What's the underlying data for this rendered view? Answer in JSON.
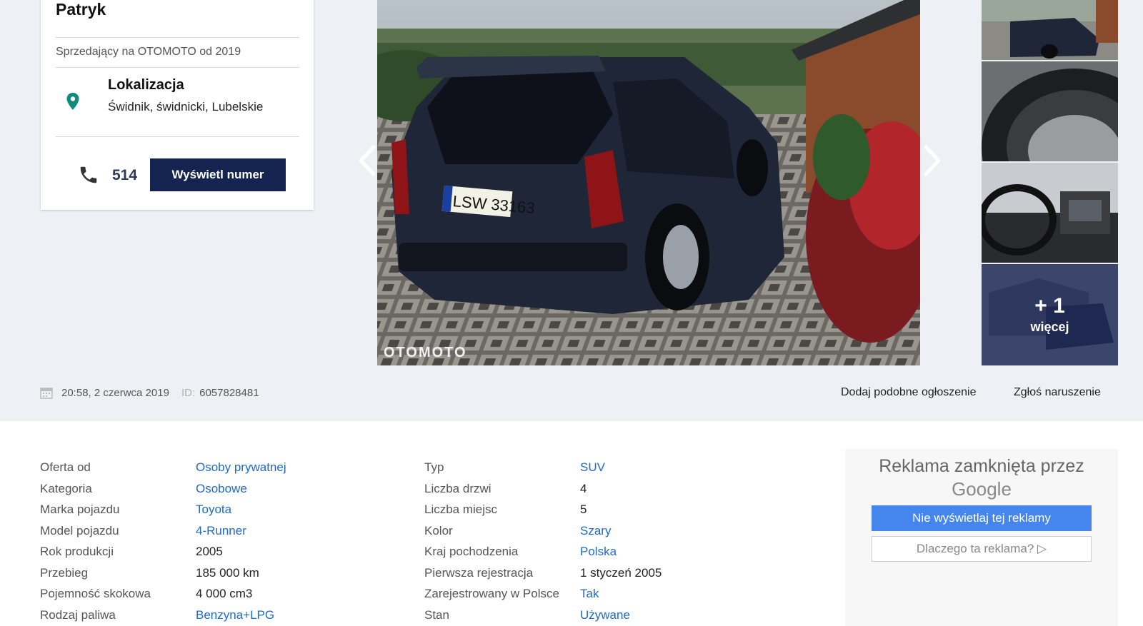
{
  "seller": {
    "name": "Patryk",
    "since": "Sprzedający na OTOMOTO od 2019",
    "location_label": "Lokalizacja",
    "location_value": "Świdnik, świdnicki, Lubelskie",
    "phone_prefix": "514",
    "show_number_label": "Wyświetl numer"
  },
  "gallery": {
    "watermark": "OTOMOTO",
    "plate": "LSW 33163",
    "more_count": "+ 1",
    "more_label": "więcej"
  },
  "meta": {
    "datetime": "20:58, 2 czerwca 2019",
    "id_label": "ID:",
    "id_value": "6057828481",
    "add_similar": "Dodaj podobne ogłoszenie",
    "report": "Zgłoś naruszenie"
  },
  "params_left": [
    {
      "label": "Oferta od",
      "value": "Osoby prywatnej",
      "link": true
    },
    {
      "label": "Kategoria",
      "value": "Osobowe",
      "link": true
    },
    {
      "label": "Marka pojazdu",
      "value": "Toyota",
      "link": true
    },
    {
      "label": "Model pojazdu",
      "value": "4-Runner",
      "link": true
    },
    {
      "label": "Rok produkcji",
      "value": "2005",
      "link": false
    },
    {
      "label": "Przebieg",
      "value": "185 000 km",
      "link": false
    },
    {
      "label": "Pojemność skokowa",
      "value": "4 000 cm3",
      "link": false
    },
    {
      "label": "Rodzaj paliwa",
      "value": "Benzyna+LPG",
      "link": true
    }
  ],
  "params_right": [
    {
      "label": "Typ",
      "value": "SUV",
      "link": true
    },
    {
      "label": "Liczba drzwi",
      "value": "4",
      "link": false
    },
    {
      "label": "Liczba miejsc",
      "value": "5",
      "link": false
    },
    {
      "label": "Kolor",
      "value": "Szary",
      "link": true
    },
    {
      "label": "Kraj pochodzenia",
      "value": "Polska",
      "link": true
    },
    {
      "label": "Pierwsza rejestracja",
      "value": "1 styczeń 2005",
      "link": false
    },
    {
      "label": "Zarejestrowany w Polsce",
      "value": "Tak",
      "link": true
    },
    {
      "label": "Stan",
      "value": "Używane",
      "link": true
    }
  ],
  "ad": {
    "title": "Reklama zamknięta przez",
    "brand": "Google",
    "hide_label": "Nie wyświetlaj tej reklamy",
    "why_label": "Dlaczego ta reklama? ▷"
  },
  "colors": {
    "brand_navy": "#14234f",
    "link": "#1d6ac8",
    "pin": "#0e8c7a",
    "ad_button": "#4485ee"
  },
  "icons": [
    "location-pin-icon",
    "phone-icon",
    "calendar-icon",
    "chevron-left-icon",
    "chevron-right-icon"
  ]
}
